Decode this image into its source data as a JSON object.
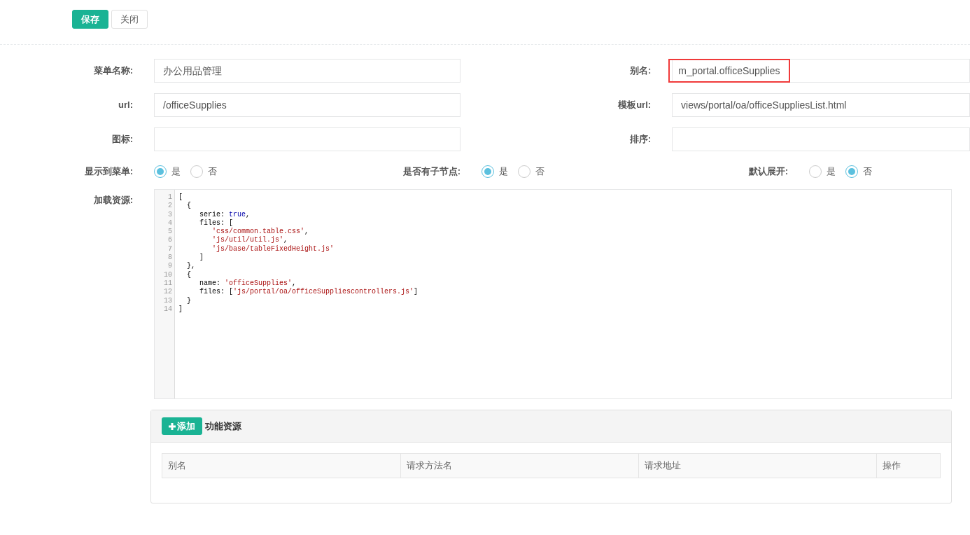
{
  "toolbar": [
    {
      "label": "保存",
      "kind": "primary"
    },
    {
      "label": "关闭",
      "kind": "default"
    }
  ],
  "fields": [
    {
      "label": "菜单名称:",
      "value": "办公用品管理"
    },
    {
      "label": "别名:",
      "value": "m_portal.officeSupplies",
      "highlighted": true
    },
    {
      "label": "url:",
      "value": "/officeSupplies"
    },
    {
      "label": "模板url:",
      "value": "views/portal/oa/officeSuppliesList.html"
    },
    {
      "label": "图标:"
    },
    {
      "label": "排序:"
    }
  ],
  "radio_groups": [
    {
      "label": "显示到菜单:",
      "options": [
        {
          "label": "是",
          "selected": true
        },
        {
          "label": "否",
          "selected": false
        }
      ]
    },
    {
      "label": "是否有子节点:",
      "options": [
        {
          "label": "是",
          "selected": true
        },
        {
          "label": "否",
          "selected": false
        }
      ]
    },
    {
      "label": "默认展开:",
      "options": [
        {
          "label": "是",
          "selected": false
        },
        {
          "label": "否",
          "selected": true
        }
      ]
    }
  ],
  "resources": {
    "label": "加载资源:",
    "lines": [
      {
        "number": "1",
        "tokens": [
          {
            "kind": "plain",
            "text": "["
          }
        ]
      },
      {
        "number": "2",
        "tokens": [
          {
            "kind": "plain",
            "text": "  {"
          }
        ]
      },
      {
        "number": "3",
        "tokens": [
          {
            "kind": "plain",
            "text": "     serie: "
          },
          {
            "kind": "keyword",
            "text": "true"
          },
          {
            "kind": "plain",
            "text": ","
          }
        ]
      },
      {
        "number": "4",
        "tokens": [
          {
            "kind": "plain",
            "text": "     files: ["
          }
        ]
      },
      {
        "number": "5",
        "tokens": [
          {
            "kind": "string",
            "text": "        'css/common.table.css'"
          },
          {
            "kind": "plain",
            "text": ","
          }
        ]
      },
      {
        "number": "6",
        "tokens": [
          {
            "kind": "string",
            "text": "        'js/util/util.js'"
          },
          {
            "kind": "plain",
            "text": ","
          }
        ]
      },
      {
        "number": "7",
        "tokens": [
          {
            "kind": "string",
            "text": "        'js/base/tableFixedHeight.js'"
          }
        ]
      },
      {
        "number": "8",
        "tokens": [
          {
            "kind": "plain",
            "text": "     ]"
          }
        ]
      },
      {
        "number": "9",
        "tokens": [
          {
            "kind": "plain",
            "text": "  },"
          }
        ]
      },
      {
        "number": "10",
        "tokens": [
          {
            "kind": "plain",
            "text": "  {"
          }
        ]
      },
      {
        "number": "11",
        "tokens": [
          {
            "kind": "plain",
            "text": "     name: "
          },
          {
            "kind": "string",
            "text": "'officeSupplies'"
          },
          {
            "kind": "plain",
            "text": ","
          }
        ]
      },
      {
        "number": "12",
        "tokens": [
          {
            "kind": "plain",
            "text": "     files: ["
          },
          {
            "kind": "string",
            "text": "'js/portal/oa/officeSuppliescontrollers.js'"
          },
          {
            "kind": "plain",
            "text": "]"
          }
        ]
      },
      {
        "number": "13",
        "tokens": [
          {
            "kind": "plain",
            "text": "  }"
          }
        ]
      },
      {
        "number": "14",
        "tokens": [
          {
            "kind": "plain",
            "text": "]"
          }
        ]
      }
    ]
  },
  "function_panel": {
    "add_button": "添加",
    "title": "功能资源",
    "table": {
      "columns": [
        "别名",
        "请求方法名",
        "请求地址",
        "操作"
      ]
    }
  }
}
